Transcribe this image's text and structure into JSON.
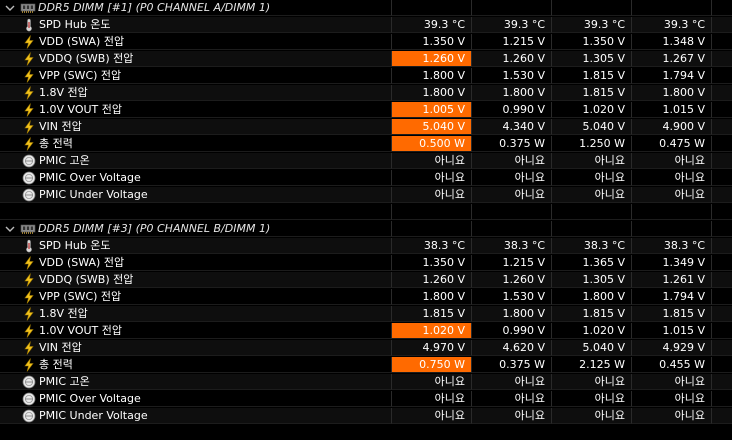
{
  "groups": [
    {
      "title": "DDR5 DIMM [#1] (P0 CHANNEL A/DIMM 1)",
      "rows": [
        {
          "label": "SPD Hub 온도",
          "icon": "thermometer-icon",
          "values": [
            "39.3 °C",
            "39.3 °C",
            "39.3 °C",
            "39.3 °C"
          ],
          "highlight": false
        },
        {
          "label": "VDD (SWA) 전압",
          "icon": "lightning-icon",
          "values": [
            "1.350 V",
            "1.215 V",
            "1.350 V",
            "1.348 V"
          ],
          "highlight": false
        },
        {
          "label": "VDDQ (SWB) 전압",
          "icon": "lightning-icon",
          "values": [
            "1.260 V",
            "1.260 V",
            "1.305 V",
            "1.267 V"
          ],
          "highlight": true
        },
        {
          "label": "VPP (SWC) 전압",
          "icon": "lightning-icon",
          "values": [
            "1.800 V",
            "1.530 V",
            "1.815 V",
            "1.794 V"
          ],
          "highlight": false
        },
        {
          "label": "1.8V 전압",
          "icon": "lightning-icon",
          "values": [
            "1.800 V",
            "1.800 V",
            "1.815 V",
            "1.800 V"
          ],
          "highlight": false
        },
        {
          "label": "1.0V VOUT 전압",
          "icon": "lightning-icon",
          "values": [
            "1.005 V",
            "0.990 V",
            "1.020 V",
            "1.015 V"
          ],
          "highlight": true
        },
        {
          "label": "VIN 전압",
          "icon": "lightning-icon",
          "values": [
            "5.040 V",
            "4.340 V",
            "5.040 V",
            "4.900 V"
          ],
          "highlight": true
        },
        {
          "label": "총 전력",
          "icon": "lightning-icon",
          "values": [
            "0.500 W",
            "0.375 W",
            "1.250 W",
            "0.475 W"
          ],
          "highlight": true
        },
        {
          "label": "PMIC 고온",
          "icon": "status-circle-icon",
          "values": [
            "아니요",
            "아니요",
            "아니요",
            "아니요"
          ],
          "highlight": false
        },
        {
          "label": "PMIC Over Voltage",
          "icon": "status-circle-icon",
          "values": [
            "아니요",
            "아니요",
            "아니요",
            "아니요"
          ],
          "highlight": false
        },
        {
          "label": "PMIC Under Voltage",
          "icon": "status-circle-icon",
          "values": [
            "아니요",
            "아니요",
            "아니요",
            "아니요"
          ],
          "highlight": false
        }
      ]
    },
    {
      "title": "DDR5 DIMM [#3] (P0 CHANNEL B/DIMM 1)",
      "rows": [
        {
          "label": "SPD Hub 온도",
          "icon": "thermometer-icon",
          "values": [
            "38.3 °C",
            "38.3 °C",
            "38.3 °C",
            "38.3 °C"
          ],
          "highlight": false
        },
        {
          "label": "VDD (SWA) 전압",
          "icon": "lightning-icon",
          "values": [
            "1.350 V",
            "1.215 V",
            "1.365 V",
            "1.349 V"
          ],
          "highlight": false
        },
        {
          "label": "VDDQ (SWB) 전압",
          "icon": "lightning-icon",
          "values": [
            "1.260 V",
            "1.260 V",
            "1.305 V",
            "1.261 V"
          ],
          "highlight": false
        },
        {
          "label": "VPP (SWC) 전압",
          "icon": "lightning-icon",
          "values": [
            "1.800 V",
            "1.530 V",
            "1.800 V",
            "1.794 V"
          ],
          "highlight": false
        },
        {
          "label": "1.8V 전압",
          "icon": "lightning-icon",
          "values": [
            "1.815 V",
            "1.800 V",
            "1.815 V",
            "1.815 V"
          ],
          "highlight": false
        },
        {
          "label": "1.0V VOUT 전압",
          "icon": "lightning-icon",
          "values": [
            "1.020 V",
            "0.990 V",
            "1.020 V",
            "1.015 V"
          ],
          "highlight": true
        },
        {
          "label": "VIN 전압",
          "icon": "lightning-icon",
          "values": [
            "4.970 V",
            "4.620 V",
            "5.040 V",
            "4.929 V"
          ],
          "highlight": false
        },
        {
          "label": "총 전력",
          "icon": "lightning-icon",
          "values": [
            "0.750 W",
            "0.375 W",
            "2.125 W",
            "0.455 W"
          ],
          "highlight": true
        },
        {
          "label": "PMIC 고온",
          "icon": "status-circle-icon",
          "values": [
            "아니요",
            "아니요",
            "아니요",
            "아니요"
          ],
          "highlight": false
        },
        {
          "label": "PMIC Over Voltage",
          "icon": "status-circle-icon",
          "values": [
            "아니요",
            "아니요",
            "아니요",
            "아니요"
          ],
          "highlight": false
        },
        {
          "label": "PMIC Under Voltage",
          "icon": "status-circle-icon",
          "values": [
            "아니요",
            "아니요",
            "아니요",
            "아니요"
          ],
          "highlight": false
        }
      ]
    }
  ],
  "colors": {
    "highlight": "#ff6a00",
    "background": "#000000",
    "band": "#0e0e0e",
    "lightning": "#f0c020",
    "text": "#ffffff"
  }
}
